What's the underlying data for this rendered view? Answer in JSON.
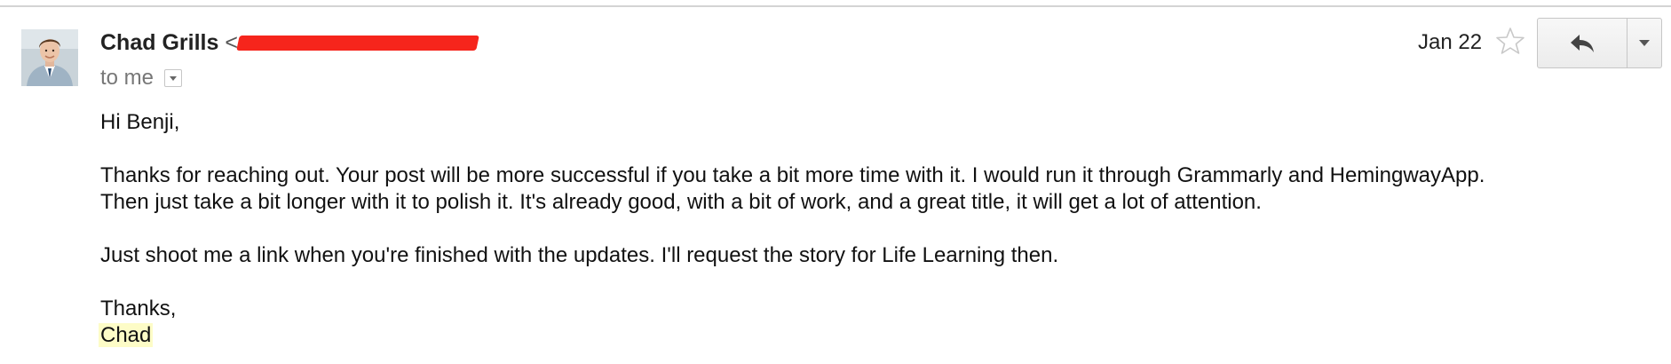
{
  "email": {
    "sender_name": "Chad Grills",
    "sender_email_prefix": "<",
    "recipient": "to me",
    "date": "Jan 22",
    "body": {
      "greeting": "Hi Benji,",
      "paragraph1_line1": "Thanks for reaching out. Your post will be more successful if you take a bit more time with it. I would run it through Grammarly and HemingwayApp.",
      "paragraph1_line2": "Then just take a bit longer with it to polish it. It's already good, with a bit of work, and a great title, it will get a lot of attention.",
      "paragraph2": "Just shoot me a link when you're finished with the updates. I'll request the story for Life Learning then.",
      "closing": "Thanks,",
      "signature": "Chad"
    }
  },
  "icons": {
    "star": "star-outline-icon",
    "reply": "reply-arrow-icon",
    "more": "chevron-down-icon",
    "details": "show-details-icon"
  },
  "colors": {
    "redaction": "#f6251c",
    "signature_highlight": "#fdfcc7",
    "muted_text": "#777777",
    "divider": "#d4d4d4"
  }
}
